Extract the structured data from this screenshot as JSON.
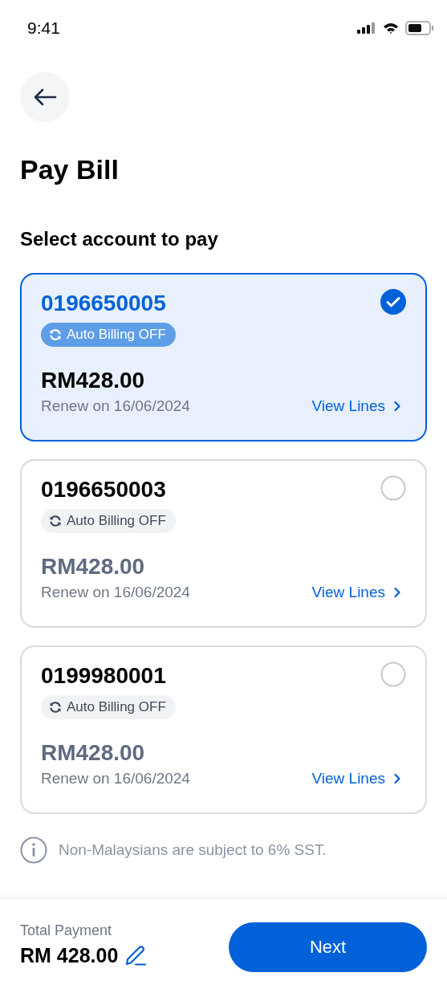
{
  "status_bar": {
    "time": "9:41"
  },
  "title": "Pay Bill",
  "section_title": "Select account to pay",
  "accounts": [
    {
      "number": "0196650005",
      "auto_billing": "Auto Billing OFF",
      "amount": "RM428.00",
      "renew": "Renew on 16/06/2024",
      "link": "View Lines",
      "selected": true
    },
    {
      "number": "0196650003",
      "auto_billing": "Auto Billing OFF",
      "amount": "RM428.00",
      "renew": "Renew on 16/06/2024",
      "link": "View Lines",
      "selected": false
    },
    {
      "number": "0199980001",
      "auto_billing": "Auto Billing OFF",
      "amount": "RM428.00",
      "renew": "Renew on 16/06/2024",
      "link": "View Lines",
      "selected": false
    }
  ],
  "note": "Non-Malaysians are subject to 6% SST.",
  "footer": {
    "total_label": "Total Payment",
    "total": "RM 428.00",
    "button": "Next"
  }
}
